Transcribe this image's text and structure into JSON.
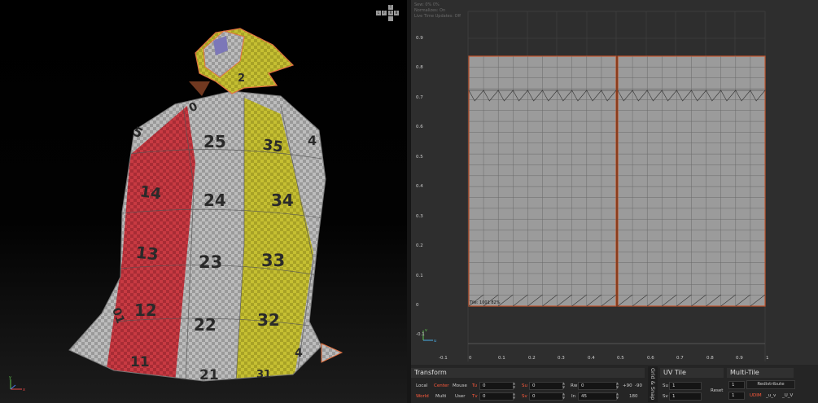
{
  "viewport_3d": {
    "patch_labels": [
      "5",
      "0",
      "2",
      "25",
      "35",
      "4",
      "14",
      "24",
      "34",
      "13",
      "23",
      "33",
      "12",
      "22",
      "32",
      "01",
      "11",
      "21",
      "31",
      "4"
    ],
    "nav_cube": [
      "T",
      "L",
      "F",
      "R",
      "B"
    ]
  },
  "uv_editor": {
    "info_lines": [
      "Sew: 0% 0%",
      "Normalizes: On",
      "Live Time Updates: Off"
    ],
    "y_ticks": [
      "0.9",
      "0.8",
      "0.7",
      "0.6",
      "0.5",
      "0.4",
      "0.3",
      "0.2",
      "0.1",
      "0",
      "-0.1"
    ],
    "x_ticks": [
      "-0.1",
      "0",
      "0.1",
      "0.2",
      "0.3",
      "0.4",
      "0.5",
      "0.6",
      "0.7",
      "0.8",
      "0.9",
      "1"
    ],
    "tile_label": "Tile: 1001 82%"
  },
  "transform": {
    "title": "Transform",
    "local": "Local",
    "world": "World",
    "center": "Center",
    "multi": "Multi",
    "mouse": "Mouse",
    "user": "User",
    "tu": "Tu",
    "tv": "Tv",
    "tu_value": "0",
    "tv_value": "0",
    "su": "Su",
    "sv": "Sv",
    "su_value": "0",
    "sv_value": "0",
    "rw": "Rw",
    "rw_value": "0",
    "in": "In",
    "in_value": "45",
    "plus90": "+90",
    "minus90": "-90",
    "r180": "180"
  },
  "grid_snap": {
    "label": "Grid & Snap"
  },
  "uv_tile": {
    "title": "UV Tile",
    "su": "Su",
    "su_value": "1",
    "sv": "Sv",
    "sv_value": "1",
    "reset": "Reset"
  },
  "multi_tile": {
    "title": "Multi-Tile",
    "top_value": "1",
    "redistribute": "Redistribute",
    "bottom_value": "1",
    "udim": "UDIM",
    "u_v": "_u_v",
    "U_V": "_U_V"
  },
  "colors": {
    "accent": "#ff5a3c",
    "uv_shell": "#9b9b9b",
    "shell_border": "#c2542c"
  }
}
